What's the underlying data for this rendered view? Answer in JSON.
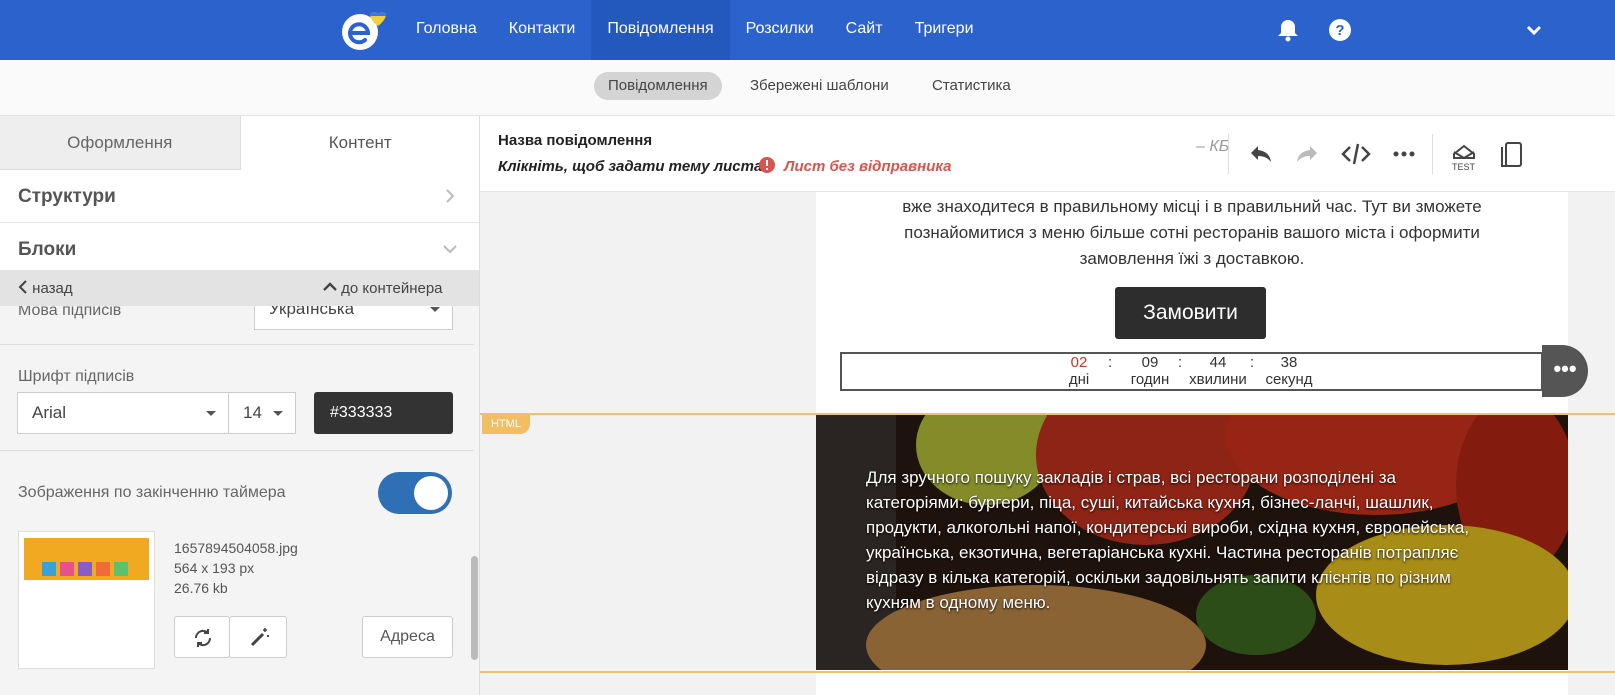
{
  "topnav": {
    "items": [
      {
        "label": "Головна",
        "active": false
      },
      {
        "label": "Контакти",
        "active": false
      },
      {
        "label": "Повідомлення",
        "active": true
      },
      {
        "label": "Розсилки",
        "active": false
      },
      {
        "label": "Сайт",
        "active": false
      },
      {
        "label": "Тригери",
        "active": false
      }
    ],
    "icons": [
      "bell-icon",
      "help-icon",
      "chevron-down-icon"
    ],
    "brand_color": "#2b62cc"
  },
  "subnav": {
    "items": [
      {
        "label": "Повідомлення",
        "active": true
      },
      {
        "label": "Збережені шаблони",
        "active": false
      },
      {
        "label": "Статистика",
        "active": false
      }
    ]
  },
  "left_panel": {
    "tabs": [
      {
        "label": "Оформлення",
        "active": false
      },
      {
        "label": "Контент",
        "active": true
      }
    ],
    "accordion": {
      "structures": "Структури",
      "blocks": "Блоки"
    },
    "nav": {
      "back": "назад",
      "to_container": "до контейнера"
    },
    "signature_lang": {
      "label": "Мова підписів",
      "value": "Українська"
    },
    "signature_font": {
      "label": "Шрифт підписів",
      "family": "Arial",
      "size": "14",
      "color": "#333333"
    },
    "timer_image": {
      "label": "Зображення по закінченню таймера",
      "enabled": true,
      "filename": "1657894504058.jpg",
      "dimensions": "564 x 193 px",
      "size": "26.76 kb",
      "address_button": "Адреса"
    }
  },
  "editor": {
    "title": "Назва повідомлення",
    "subject_prompt": "Клікніть, щоб задати тему листа",
    "warning": "Лист без відправника",
    "size_label": "– КБ",
    "test_label": "TEST",
    "body": {
      "paragraph": [
        "вже знаходитеся в правильному місці і в правильний час. Тут ви зможете",
        "познайомитися з меню більше сотні ресторанів вашого міста і оформити",
        "замовлення їжі з доставкою."
      ],
      "order_button": "Замовити",
      "timer": [
        {
          "value": "02",
          "unit": "дні"
        },
        {
          "value": "09",
          "unit": "годин"
        },
        {
          "value": "44",
          "unit": "хвилини"
        },
        {
          "value": "38",
          "unit": "секунд"
        }
      ],
      "html_tag": "HTML",
      "banner_text": "Для зручного пошуку закладів і страв, всі ресторани розподілені за категоріями: бургери, піца, суші, китайська кухня, бізнес-ланчі, шашлик, продукти, алкогольні напої, кондитерські вироби, східна кухня, європейська, українська, екзотична, вегетаріанська кухні. Частина ресторанів потрапляє відразу в кілька категорій, оскільки задовільнять запити клієнтів по різним кухням в одному меню."
    }
  }
}
